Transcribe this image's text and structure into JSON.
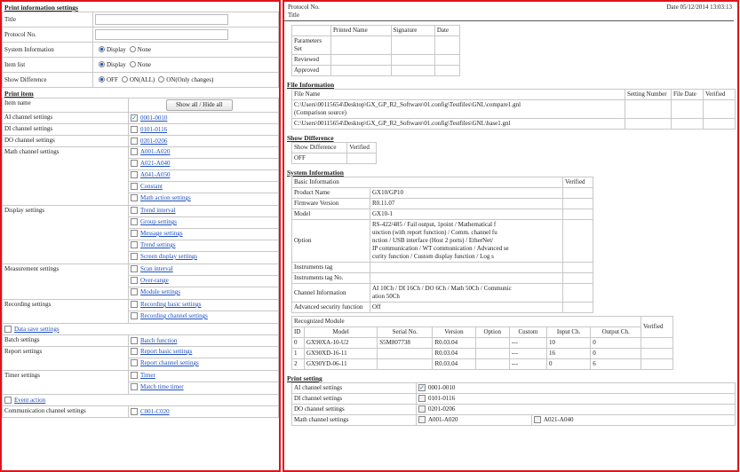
{
  "left": {
    "print_info_heading": "Print information settings",
    "title_label": "Title",
    "protocol_label": "Protocol No.",
    "sysinfo_label": "System Information",
    "itemlist_label": "Item list",
    "showdiff_label": "Show Difference",
    "opt_display": "Display",
    "opt_none": "None",
    "opt_off": "OFF",
    "opt_on_all": "ON(ALL)",
    "opt_on_only": "ON(Only changes)",
    "print_item_heading": "Print item",
    "item_name_label": "Item name",
    "show_all_button": "Show all / Hide all",
    "ai_label": "AI channel settings",
    "ai_link": "0001-0010",
    "di_label": "DI channel settings",
    "di_link": "0101-0116",
    "do_label": "DO channel settings",
    "do_link": "0201-0206",
    "math_label": "Math channel settings",
    "math_links": [
      "A001-A020",
      "A021-A040",
      "A041-A050",
      "Constant",
      "Math action settings"
    ],
    "display_label": "Display settings",
    "display_links": [
      "Trend interval",
      "Group settings",
      "Message settings",
      "Trend settings",
      "Screen display settings"
    ],
    "meas_label": "Measurement settings",
    "meas_links": [
      "Scan interval",
      "Over-range",
      "Module settings"
    ],
    "rec_label": "Recording settings",
    "rec_links": [
      "Recording basic settings",
      "Recording channel settings"
    ],
    "data_save_link": "Data save settings",
    "batch_label": "Batch settings",
    "batch_link": "Batch function",
    "report_label": "Report settings",
    "report_links": [
      "Report basic settings",
      "Report channel settings"
    ],
    "timer_label": "Timer settings",
    "timer_links": [
      "Timer",
      "Match time timer"
    ],
    "event_link": "Event action",
    "comm_label": "Communication channel settings",
    "comm_link": "C001-C020",
    "checkmark": "✓",
    "scroll_glyph": "⁞"
  },
  "right": {
    "protocol_label": "Protocol No.",
    "date_text": "Date 05/12/2014 13:03:13",
    "title_label": "Title",
    "sig_headers": [
      "Printed Name",
      "Signature",
      "Date"
    ],
    "sig_rows": [
      "Parameters Set",
      "Reviewed",
      "Approved"
    ],
    "file_info_heading": "File Information",
    "file_headers": [
      "File Name",
      "Setting Number",
      "File Date",
      "Verified"
    ],
    "file_path1": "C:\\Users\\00115654\\Desktop\\GX_GP_R2_Software\\01.config\\Testfiles\\GNL\\compare1.gnl",
    "file_path1_note": "(Comparison source)",
    "file_path2": "C:\\Users\\00115654\\Desktop\\GX_GP_R2_Software\\01.config\\Testfiles\\GNL\\base1.gnl",
    "show_diff_heading": "Show Difference",
    "show_diff_headers": [
      "Show Difference",
      "Verified"
    ],
    "show_diff_value": "OFF",
    "sys_info_heading": "System Information",
    "basic_info_label": "Basic Information",
    "verified_label": "Verified",
    "product_name_label": "Product Name",
    "product_name": "GX10/GP10",
    "firmware_label": "Firmware Version",
    "firmware": "R0.11.07",
    "model_label": "Model",
    "model": "GX10-1",
    "option_label": "Option",
    "option_lines": [
      "RS-422/485 / Fail output, 1point / Mathematical f",
      "unction (with report function) / Comm. channel fu",
      "nction / USB interface (Host 2 ports) / EtherNet/",
      "IP communication / WT communication / Advanced se",
      "curity function / Custom display function / Log s"
    ],
    "instr_tag_label": "Instruments tag",
    "instr_tagno_label": "Instruments tag No.",
    "channel_info_label": "Channel Information",
    "channel_info_lines": [
      "AI 10Ch / DI 16Ch / DO 6Ch / Math 50Ch / Communic",
      "ation 50Ch"
    ],
    "adv_sec_label": "Advanced security function",
    "adv_sec_value": "Off",
    "recog_label": "Recognized Module",
    "module_headers": [
      "ID",
      "Model",
      "Serial No.",
      "Version",
      "Option",
      "Custom",
      "Input Ch.",
      "Output Ch."
    ],
    "modules": [
      [
        "0",
        "GX90XA-10-U2",
        "S5M807738",
        "R0.03.04",
        "",
        "---",
        "10",
        "0"
      ],
      [
        "1",
        "GX90XD-16-11",
        "",
        "R0.03.04",
        "",
        "---",
        "16",
        "0"
      ],
      [
        "2",
        "GX90YD-06-11",
        "",
        "R0.03.04",
        "",
        "---",
        "0",
        "6"
      ]
    ],
    "print_setting_heading": "Print setting",
    "ps_ai_label": "AI channel settings",
    "ps_ai_value": "0001-0010",
    "ps_di_label": "DI channel settings",
    "ps_di_value": "0101-0116",
    "ps_do_label": "DO channel settings",
    "ps_do_value": "0201-0206",
    "ps_math_label": "Math channel settings",
    "ps_math_values": [
      "A001-A020",
      "A021-A040"
    ]
  }
}
